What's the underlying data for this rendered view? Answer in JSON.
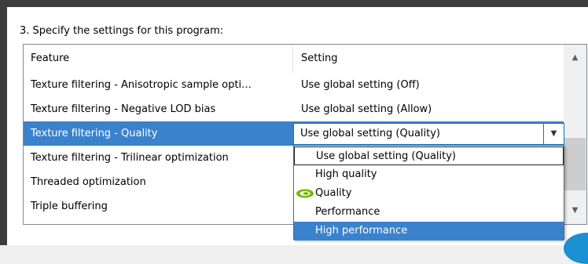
{
  "instruction": "3. Specify the settings for this program:",
  "table": {
    "columns": [
      "Feature",
      "Setting"
    ],
    "rows": [
      {
        "feature": "Texture filtering - Anisotropic sample opti…",
        "setting": "Use global setting (Off)"
      },
      {
        "feature": "Texture filtering - Negative LOD bias",
        "setting": "Use global setting (Allow)"
      },
      {
        "feature": "Texture filtering - Quality",
        "setting": "Use global setting (Quality)"
      },
      {
        "feature": "Texture filtering - Trilinear optimization",
        "setting": ""
      },
      {
        "feature": "Threaded optimization",
        "setting": ""
      },
      {
        "feature": "Triple buffering",
        "setting": ""
      }
    ],
    "selected_row_index": 2
  },
  "combo": {
    "value": "Use global setting (Quality)",
    "arrow_icon": "chevron-down-icon"
  },
  "dropdown": {
    "options": [
      "Use global setting (Quality)",
      "High quality",
      "Quality",
      "Performance",
      "High performance"
    ],
    "focused_index": 0,
    "highlighted_index": 4,
    "marked_index": 2,
    "marker_icon": "nvidia-logo-icon"
  },
  "scrollbar": {
    "up_icon": "chevron-up-icon",
    "down_icon": "chevron-down-icon"
  },
  "colors": {
    "selection": "#3a82cc",
    "focus_border": "#0078d7",
    "frame": "#3d3d3d",
    "nvidia_green": "#76b900"
  }
}
